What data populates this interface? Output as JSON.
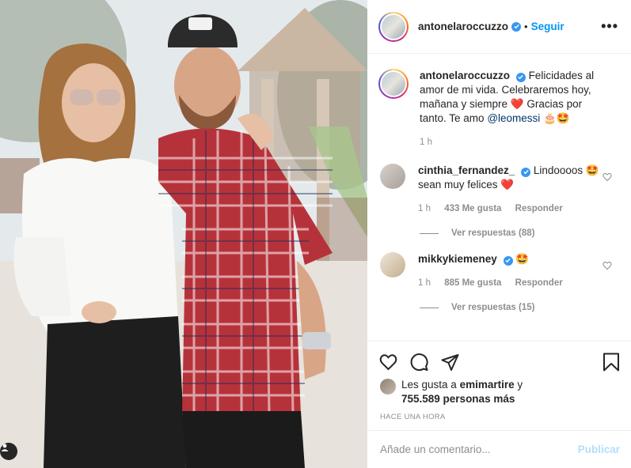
{
  "post": {
    "author": "antonelaroccuzzo",
    "follow_label": "Seguir",
    "separator": "•",
    "more_label": "•••"
  },
  "caption": {
    "author": "antonelaroccuzzo",
    "text": "Felicidades al amor de mi vida. Celebraremos hoy, mañana y siempre",
    "heart": "❤️",
    "text2": "Gracias por tanto. Te amo",
    "mention": "@leomessi",
    "emojis": "🎂🤩",
    "time": "1 h"
  },
  "comments": [
    {
      "author": "cinthia_fernandez_",
      "text1": "Lindoooos",
      "emoji": "🤩",
      "text2": "sean muy felices",
      "heart": "❤️",
      "time": "1 h",
      "likes": "433 Me gusta",
      "reply_label": "Responder",
      "view_replies": "Ver respuestas (88)"
    },
    {
      "author": "mikkykiemeney",
      "text1": "",
      "emoji": "🤩",
      "time": "1 h",
      "likes": "885 Me gusta",
      "reply_label": "Responder",
      "view_replies": "Ver respuestas (15)"
    }
  ],
  "likes": {
    "prefix": "Les gusta a",
    "user": "emimartire",
    "connector": "y",
    "count": "755.589 personas más"
  },
  "timestamp": "HACE UNA HORA",
  "comment_input": {
    "placeholder": "Añade un comentario...",
    "publish_label": "Publicar"
  },
  "icons": {
    "like": "heart-outline-icon",
    "comment": "comment-bubble-icon",
    "share": "paper-plane-icon",
    "save": "bookmark-icon",
    "user_tag": "user-tag-icon",
    "verified": "verified-badge-icon"
  },
  "colors": {
    "accent": "#0095f6",
    "verified": "#3897f0",
    "heart": "#ed4956",
    "publish_disabled": "#b2dffc"
  }
}
